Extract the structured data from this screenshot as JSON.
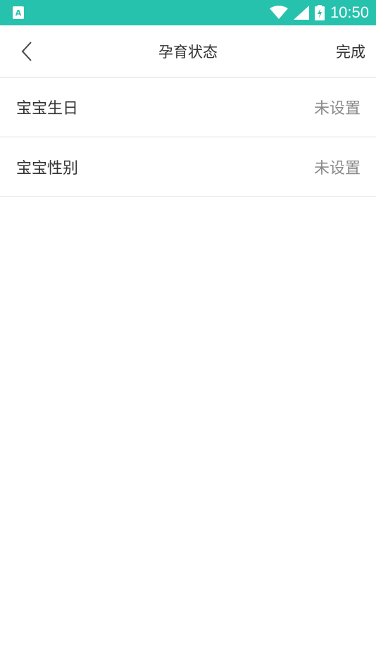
{
  "status_bar": {
    "app_icon_letter": "A",
    "time": "10:50",
    "icons": [
      "wifi-icon",
      "signal-icon",
      "battery-charging-icon"
    ]
  },
  "nav": {
    "back_icon": "chevron-left-icon",
    "title": "孕育状态",
    "done_label": "完成"
  },
  "rows": [
    {
      "label": "宝宝生日",
      "value": "未设置"
    },
    {
      "label": "宝宝性别",
      "value": "未设置"
    }
  ],
  "colors": {
    "status_bar_bg": "#26c2ae",
    "text_primary": "#333333",
    "text_secondary": "#8a8a8a"
  }
}
